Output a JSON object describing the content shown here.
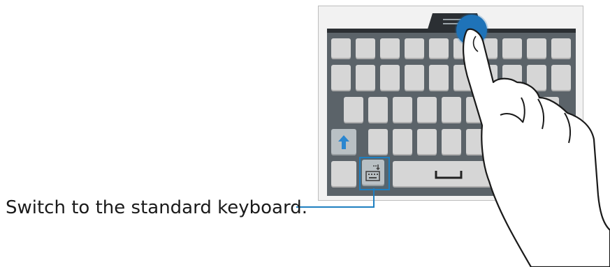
{
  "callout": {
    "text": "Switch to the standard keyboard."
  },
  "icons": {
    "shift": "shift-arrow-icon",
    "keyboard_switch": "keyboard-switch-icon",
    "space": "space-bar-icon",
    "hand": "pointing-hand-icon"
  },
  "colors": {
    "keyboard_bg": "#5b6369",
    "key": "#d6d6d6",
    "accent": "#1e7fc0",
    "touch": "#1f73b8"
  }
}
